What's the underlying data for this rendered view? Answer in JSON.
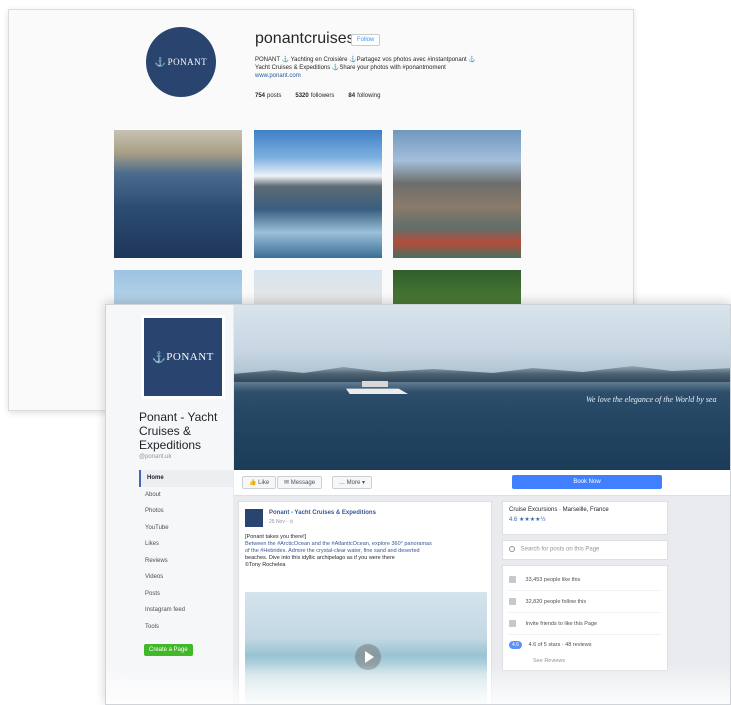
{
  "instagram": {
    "brand": "PONANT",
    "username": "ponantcruises",
    "follow_label": "Follow",
    "bio_line1": "PONANT ⚓ Yachting en Croisière ⚓Partagez vos photos avec #instantponant ⚓",
    "bio_line2": "Yacht Cruises & Expeditions ⚓Share your photos with #ponantmoment",
    "bio_link": "www.ponant.com",
    "stats": {
      "posts_count": "754",
      "posts_label": "posts",
      "followers_count": "5320",
      "followers_label": "followers",
      "following_count": "84",
      "following_label": "following"
    }
  },
  "facebook": {
    "brand": "PONANT",
    "page_name": "Ponant - Yacht Cruises & Expeditions",
    "handle": "@ponant.uk",
    "nav": [
      "Home",
      "About",
      "Photos",
      "YouTube",
      "Likes",
      "Reviews",
      "Videos",
      "Posts",
      "Instagram feed",
      "Tools"
    ],
    "create_page_label": "Create a Page",
    "cover_tagline": "We love the elegance of the World by sea",
    "actions": {
      "like": "Like",
      "message": "Message",
      "more": "More"
    },
    "shop_now_label": "Book Now",
    "post": {
      "author": "Ponant - Yacht Cruises & Expeditions",
      "date": "25 Nov · ⊙",
      "text_line1": "[Ponant takes you there!]",
      "text_line2": "Between the #ArcticOcean and the #AtlanticOcean, explore 360° panoramas",
      "text_line3": "of the #Hebrides. Admire the crystal-clear water, fine sand and deserted",
      "text_line4": "beaches. Dive into this idyllic archipelago as if you were there",
      "text_line5": "©Tony Rochelea"
    },
    "sidebar": {
      "category": "Cruise Excursions · Marseille, France",
      "rating": "4.6 ★★★★½",
      "search_placeholder": "Search for posts on this Page",
      "stat1": "33,453 people like this",
      "stat2": "32,820 people follow this",
      "stat3": "Invite friends to like this Page",
      "review_badge": "4.6",
      "review_text": "4.6 of 5 stars · 48 reviews",
      "review_sub": "See Reviews"
    }
  }
}
